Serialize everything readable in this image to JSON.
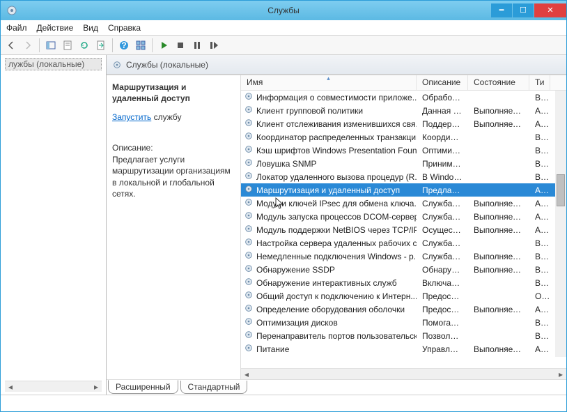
{
  "window": {
    "title": "Службы"
  },
  "menu": {
    "file": "Файл",
    "action": "Действие",
    "view": "Вид",
    "help": "Справка"
  },
  "tree": {
    "root": "лужбы (локальные)"
  },
  "pane_header": "Службы (локальные)",
  "detail": {
    "service_name": "Маршрутизация и удаленный доступ",
    "action_link": "Запустить",
    "action_suffix": " службу",
    "desc_label": "Описание:",
    "desc_text": "Предлагает услуги маршрутизации организациям в локальной и глобальной сетях."
  },
  "columns": {
    "name": "Имя",
    "desc": "Описание",
    "state": "Состояние",
    "type": "Ти"
  },
  "services": [
    {
      "name": "Информация о совместимости приложе...",
      "desc": "Обработк...",
      "state": "",
      "type": "Вр"
    },
    {
      "name": "Клиент групповой политики",
      "desc": "Данная сл...",
      "state": "Выполняется",
      "type": "Ав"
    },
    {
      "name": "Клиент отслеживания изменившихся свя...",
      "desc": "Поддержи...",
      "state": "Выполняется",
      "type": "Ав"
    },
    {
      "name": "Координатор распределенных транзакций",
      "desc": "Координа...",
      "state": "",
      "type": "Вр"
    },
    {
      "name": "Кэш шрифтов Windows Presentation Foun...",
      "desc": "Оптимизи...",
      "state": "",
      "type": "Вр"
    },
    {
      "name": "Ловушка SNMP",
      "desc": "Принимае...",
      "state": "",
      "type": "Вр"
    },
    {
      "name": "Локатор удаленного вызова процедур (R...",
      "desc": "В Windows...",
      "state": "",
      "type": "Вр"
    },
    {
      "name": "Маршрутизация и удаленный доступ",
      "desc": "Предлагае...",
      "state": "",
      "type": "Ав",
      "selected": true
    },
    {
      "name": "Модули ключей IPsec для обмена ключа...",
      "desc": "Служба IK...",
      "state": "Выполняется",
      "type": "Ав"
    },
    {
      "name": "Модуль запуска процессов DCOM-сервера",
      "desc": "Служба D...",
      "state": "Выполняется",
      "type": "Ав"
    },
    {
      "name": "Модуль поддержки NetBIOS через TCP/IP",
      "desc": "Осуществ...",
      "state": "Выполняется",
      "type": "Ав"
    },
    {
      "name": "Настройка сервера удаленных рабочих с...",
      "desc": "Служба на...",
      "state": "",
      "type": "Вр"
    },
    {
      "name": "Немедленные подключения Windows - р...",
      "desc": "Служба W...",
      "state": "Выполняется",
      "type": "Вр"
    },
    {
      "name": "Обнаружение SSDP",
      "desc": "Обнаружи...",
      "state": "Выполняется",
      "type": "Вр"
    },
    {
      "name": "Обнаружение интерактивных служб",
      "desc": "Включает ...",
      "state": "",
      "type": "Вр"
    },
    {
      "name": "Общий доступ к подключению к Интерн...",
      "desc": "Предостав...",
      "state": "",
      "type": "От"
    },
    {
      "name": "Определение оборудования оболочки",
      "desc": "Предостав...",
      "state": "Выполняется",
      "type": "Ав"
    },
    {
      "name": "Оптимизация дисков",
      "desc": "Помогает ...",
      "state": "",
      "type": "Вр"
    },
    {
      "name": "Перенаправитель портов пользовательск...",
      "desc": "Позволяет...",
      "state": "",
      "type": "Вр"
    },
    {
      "name": "Питание",
      "desc": "Управляет...",
      "state": "Выполняется",
      "type": "Ав"
    }
  ],
  "tabs": {
    "extended": "Расширенный",
    "standard": "Стандартный"
  }
}
